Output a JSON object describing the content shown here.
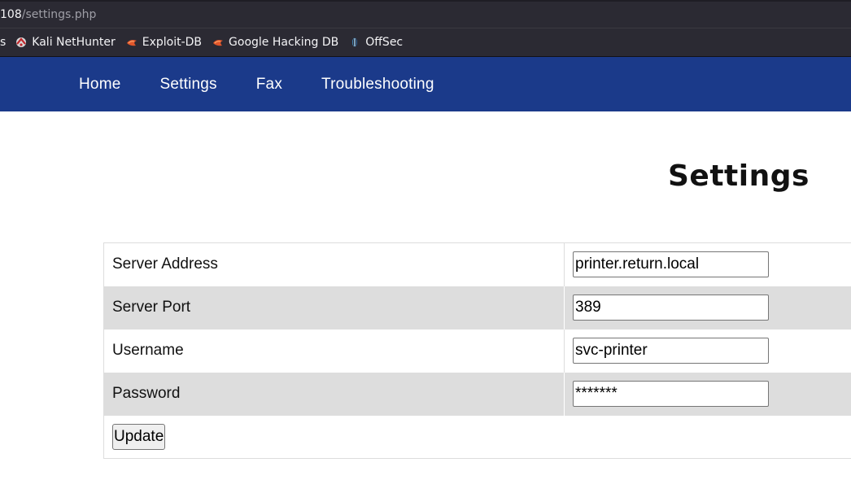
{
  "browser": {
    "url_host": "108",
    "url_path": "/settings.php",
    "bookmarks": [
      {
        "label": "s",
        "icon": "bookmark-folder-icon"
      },
      {
        "label": "Kali NetHunter",
        "icon": "kali-nethunter-icon"
      },
      {
        "label": "Exploit-DB",
        "icon": "exploit-db-icon"
      },
      {
        "label": "Google Hacking DB",
        "icon": "exploit-db-icon"
      },
      {
        "label": "OffSec",
        "icon": "offsec-icon"
      }
    ]
  },
  "nav": {
    "items": [
      "Home",
      "Settings",
      "Fax",
      "Troubleshooting"
    ],
    "background": "#1b3a8a"
  },
  "page": {
    "title": "Settings"
  },
  "form": {
    "rows": [
      {
        "label": "Server Address",
        "value": "printer.return.local"
      },
      {
        "label": "Server Port",
        "value": "389"
      },
      {
        "label": "Username",
        "value": "svc-printer"
      },
      {
        "label": "Password",
        "value": "*******"
      }
    ],
    "submit_label": "Update"
  }
}
